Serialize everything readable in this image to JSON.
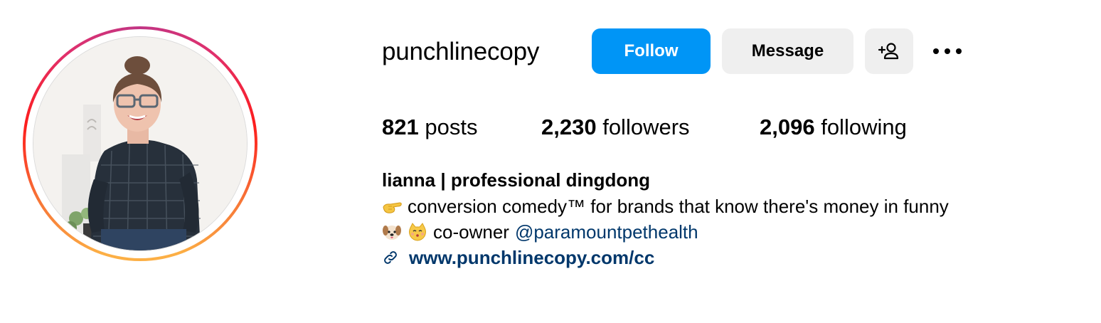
{
  "profile": {
    "username": "punchlinecopy",
    "avatar_icon": "profile-photo",
    "story_ring_colors": [
      "#fcaf45",
      "#fd1d1d",
      "#e1306c",
      "#c13584"
    ]
  },
  "actions": {
    "follow_label": "Follow",
    "message_label": "Message",
    "suggest_icon": "add-person-icon",
    "more_icon": "more-horizontal-icon"
  },
  "stats": {
    "posts": {
      "count": "821",
      "label": "posts"
    },
    "followers": {
      "count": "2,230",
      "label": "followers"
    },
    "following": {
      "count": "2,096",
      "label": "following"
    }
  },
  "bio": {
    "name": "lianna | professional dingdong",
    "line1_emoji": "pointing-hand-emoji",
    "line1_text": "conversion comedy™ for brands that know there's money in funny",
    "line2_emojis": [
      "dog-face-emoji",
      "cat-kiss-emoji"
    ],
    "line2_text": "co-owner",
    "line2_mention": "@paramountpethealth",
    "link_icon": "link-icon",
    "website": "www.punchlinecopy.com/cc"
  },
  "colors": {
    "primary": "#0095f6",
    "secondary_button": "#efefef",
    "link": "#00376b"
  }
}
